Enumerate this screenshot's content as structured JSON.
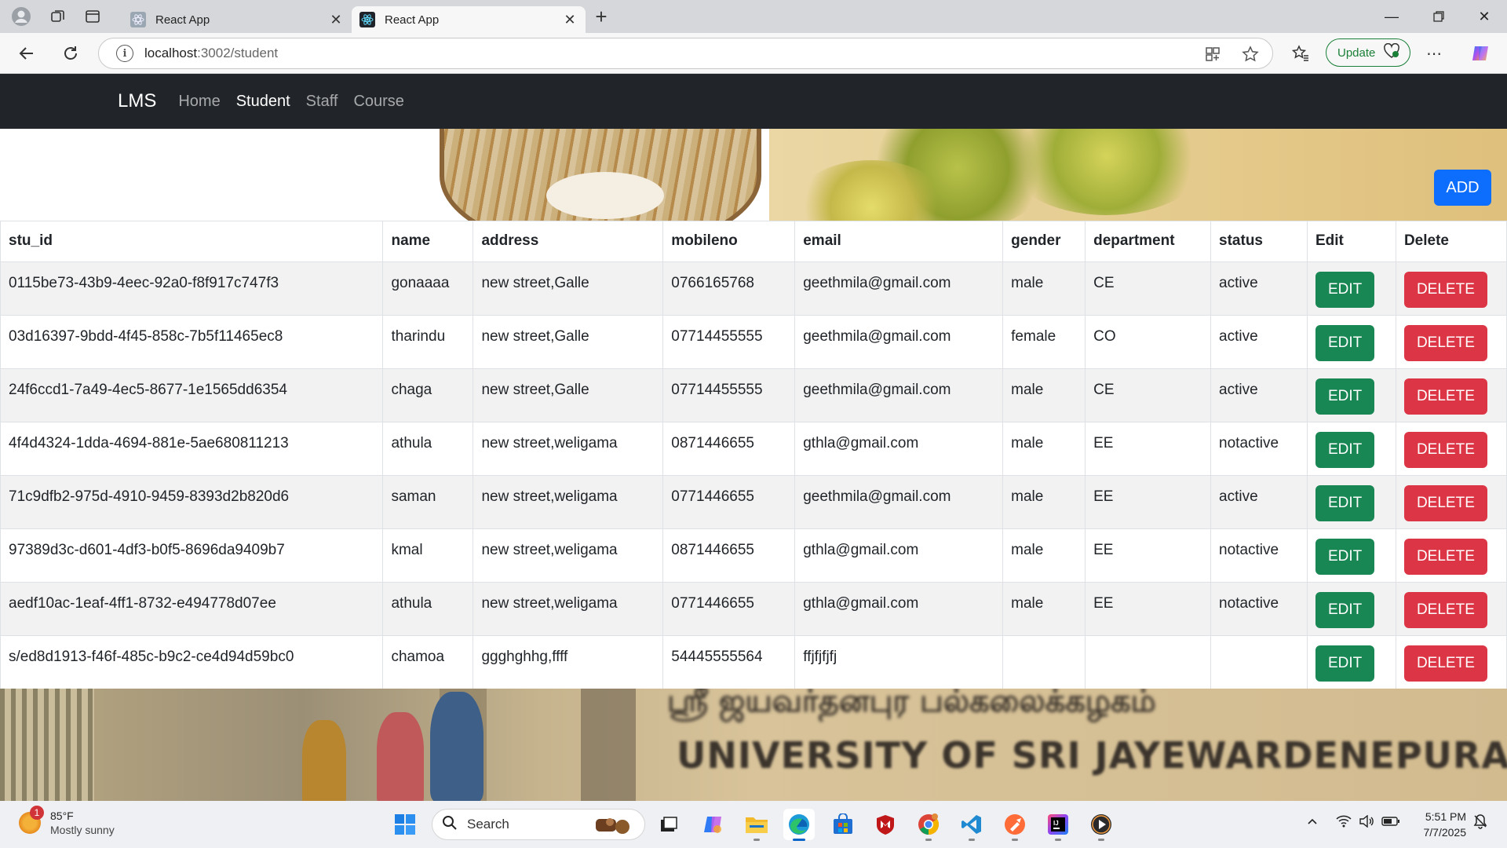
{
  "browser": {
    "tabs": [
      {
        "title": "React App",
        "active": false
      },
      {
        "title": "React App",
        "active": true
      }
    ],
    "address": {
      "host": "localhost",
      "path": ":3002/student"
    },
    "update_label": "Update"
  },
  "navbar": {
    "brand": "LMS",
    "links": [
      {
        "label": "Home",
        "active": false
      },
      {
        "label": "Student",
        "active": true
      },
      {
        "label": "Staff",
        "active": false
      },
      {
        "label": "Course",
        "active": false
      }
    ]
  },
  "add_label": "ADD",
  "table": {
    "headers": [
      "stu_id",
      "name",
      "address",
      "mobileno",
      "email",
      "gender",
      "department",
      "status",
      "Edit",
      "Delete"
    ],
    "edit_label": "EDIT",
    "delete_label": "DELETE",
    "rows": [
      {
        "stu_id": "0115be73-43b9-4eec-92a0-f8f917c747f3",
        "name": "gonaaaa",
        "address": "new street,Galle",
        "mobileno": "0766165768",
        "email": "geethmila@gmail.com",
        "gender": "male",
        "department": "CE",
        "status": "active"
      },
      {
        "stu_id": "03d16397-9bdd-4f45-858c-7b5f11465ec8",
        "name": "tharindu",
        "address": "new street,Galle",
        "mobileno": "07714455555",
        "email": "geethmila@gmail.com",
        "gender": "female",
        "department": "CO",
        "status": "active"
      },
      {
        "stu_id": "24f6ccd1-7a49-4ec5-8677-1e1565dd6354",
        "name": "chaga",
        "address": "new street,Galle",
        "mobileno": "07714455555",
        "email": "geethmila@gmail.com",
        "gender": "male",
        "department": "CE",
        "status": "active"
      },
      {
        "stu_id": "4f4d4324-1dda-4694-881e-5ae680811213",
        "name": "athula",
        "address": "new street,weligama",
        "mobileno": "0871446655",
        "email": "gthla@gmail.com",
        "gender": "male",
        "department": "EE",
        "status": "notactive"
      },
      {
        "stu_id": "71c9dfb2-975d-4910-9459-8393d2b820d6",
        "name": "saman",
        "address": "new street,weligama",
        "mobileno": "0771446655",
        "email": "geethmila@gmail.com",
        "gender": "male",
        "department": "EE",
        "status": "active"
      },
      {
        "stu_id": "97389d3c-d601-4df3-b0f5-8696da9409b7",
        "name": "kmal",
        "address": "new street,weligama",
        "mobileno": "0871446655",
        "email": "gthla@gmail.com",
        "gender": "male",
        "department": "EE",
        "status": "notactive"
      },
      {
        "stu_id": "aedf10ac-1eaf-4ff1-8732-e494778d07ee",
        "name": "athula",
        "address": "new street,weligama",
        "mobileno": "0771446655",
        "email": "gthla@gmail.com",
        "gender": "male",
        "department": "EE",
        "status": "notactive"
      },
      {
        "stu_id": "s/ed8d1913-f46f-485c-b9c2-ce4d94d59bc0",
        "name": "chamoa",
        "address": "ggghghhg,ffff",
        "mobileno": "54445555564",
        "email": "ffjfjfjfj",
        "gender": "",
        "department": "",
        "status": ""
      }
    ]
  },
  "footer_image": {
    "sign_text": "UNIVERSITY OF SRI JAYEWARDENEPURA"
  },
  "taskbar": {
    "weather_temp": "85°F",
    "weather_desc": "Mostly sunny",
    "weather_badge": "1",
    "search_label": "Search",
    "time": "5:51 PM",
    "date": "7/7/2025"
  }
}
